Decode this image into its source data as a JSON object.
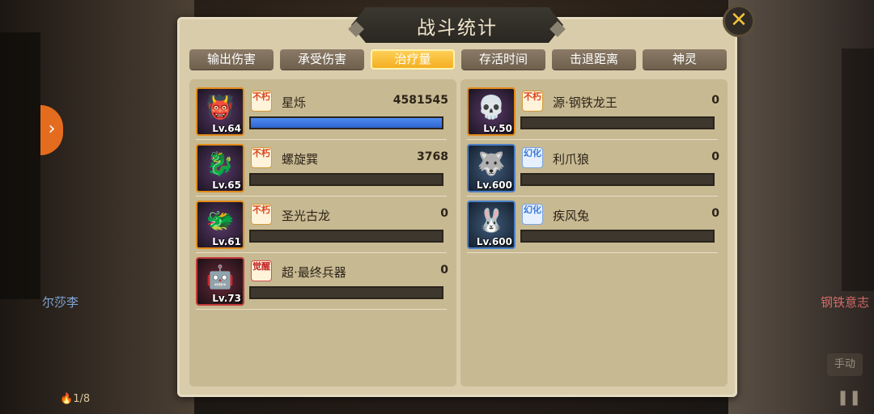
{
  "dialog": {
    "title": "战斗统计",
    "close_icon": "close-icon"
  },
  "tabs": [
    {
      "label": "输出伤害",
      "active": false
    },
    {
      "label": "承受伤害",
      "active": false
    },
    {
      "label": "治疗量",
      "active": true
    },
    {
      "label": "存活时间",
      "active": false
    },
    {
      "label": "击退距离",
      "active": false
    },
    {
      "label": "神灵",
      "active": false
    }
  ],
  "left_team": [
    {
      "name": "星烁",
      "level": "Lv.64",
      "badge": "不朽",
      "value": "4581545",
      "fill": 1.0,
      "frame": "orange",
      "icon": "dark-beast-portrait"
    },
    {
      "name": "螺旋巽",
      "level": "Lv.65",
      "badge": "不朽",
      "value": "3768",
      "fill": 0.0,
      "frame": "orange",
      "icon": "wind-beast-portrait"
    },
    {
      "name": "圣光古龙",
      "level": "Lv.61",
      "badge": "不朽",
      "value": "0",
      "fill": 0.0,
      "frame": "orange",
      "icon": "dragon-portrait"
    },
    {
      "name": "超·最终兵器",
      "level": "Lv.73",
      "badge": "觉醒",
      "value": "0",
      "fill": 0.0,
      "frame": "red",
      "icon": "weapon-portrait"
    }
  ],
  "right_team": [
    {
      "name": "源·钢铁龙王",
      "level": "Lv.50",
      "badge": "不朽",
      "value": "0",
      "fill": 0.0,
      "frame": "orange",
      "icon": "steel-dragon-portrait"
    },
    {
      "name": "利爪狼",
      "level": "Lv.600",
      "badge": "幻化",
      "value": "0",
      "fill": 0.0,
      "frame": "blue",
      "icon": "wolf-portrait"
    },
    {
      "name": "疾风兔",
      "level": "Lv.600",
      "badge": "幻化",
      "value": "0",
      "fill": 0.0,
      "frame": "blue",
      "icon": "rabbit-portrait"
    }
  ],
  "background": {
    "left_player": "尔莎李",
    "right_player": "钢铁意志",
    "energy": "1/8",
    "auto_label": "手动",
    "pause_icon": "pause-icon"
  },
  "colors": {
    "accent_tab": "#f3ac1b",
    "bar_fill": "#2e63d0",
    "panel": "#c7b992"
  }
}
